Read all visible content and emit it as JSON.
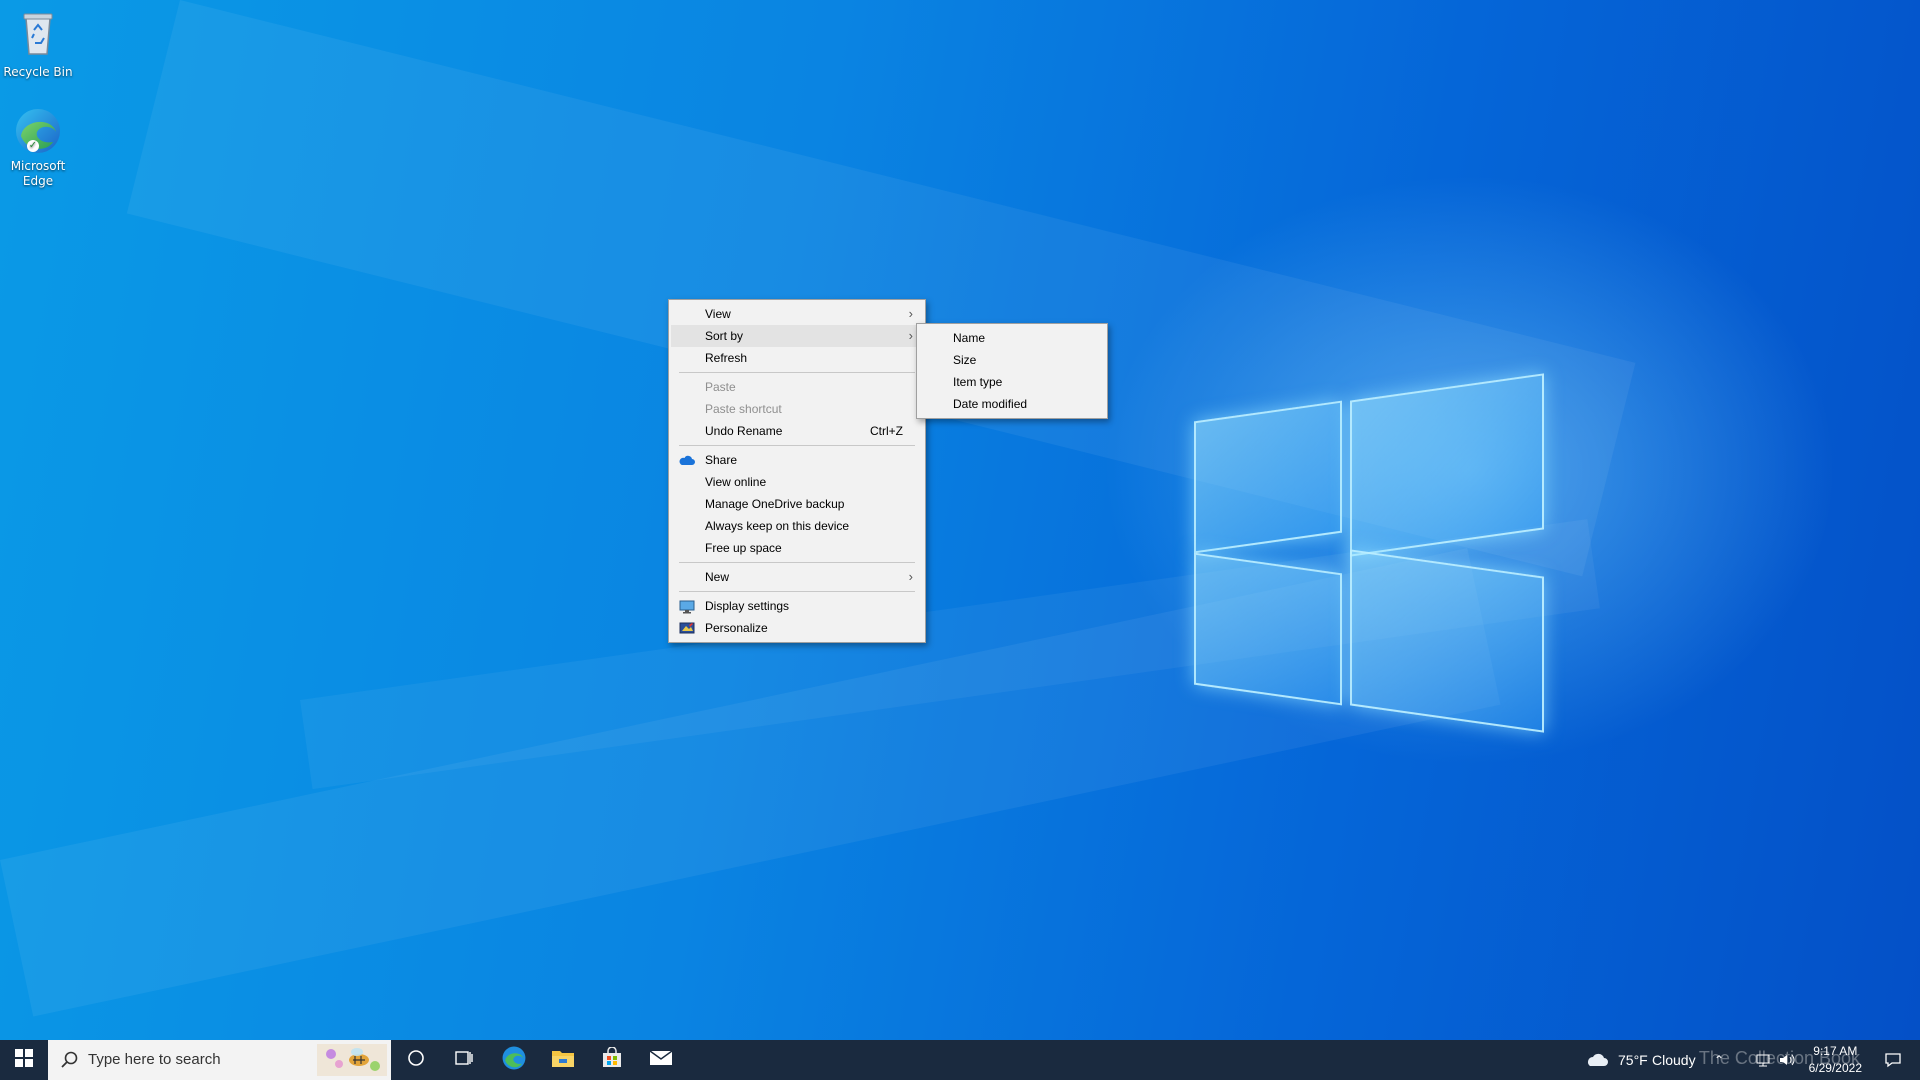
{
  "desktop": {
    "icons": [
      {
        "label": "Recycle Bin",
        "icon": "recycle-bin-icon"
      },
      {
        "label": "Microsoft Edge",
        "icon": "edge-icon"
      }
    ]
  },
  "context_menu": {
    "items": {
      "view": "View",
      "sort_by": "Sort by",
      "refresh": "Refresh",
      "paste": "Paste",
      "paste_shortcut": "Paste shortcut",
      "undo_rename": "Undo Rename",
      "undo_shortcut": "Ctrl+Z",
      "share": "Share",
      "view_online": "View online",
      "manage_onedrive": "Manage OneDrive backup",
      "always_keep": "Always keep on this device",
      "free_up": "Free up space",
      "new": "New",
      "display_settings": "Display settings",
      "personalize": "Personalize"
    },
    "highlighted": "Sort by"
  },
  "sort_submenu": {
    "items": [
      "Name",
      "Size",
      "Item type",
      "Date modified"
    ]
  },
  "taskbar": {
    "search_placeholder": "Type here to search",
    "pinned": [
      "cortana-icon",
      "task-view-icon",
      "edge-icon",
      "file-explorer-icon",
      "store-icon",
      "mail-icon"
    ],
    "weather_temp": "75°F",
    "weather_text": "Cloudy",
    "time": "9:17 AM",
    "date": "6/29/2022",
    "watermark": "The Collection Book"
  },
  "colors": {
    "taskbar_bg": "#1a2a3f",
    "menu_bg": "#f2f2f2",
    "menu_highlight": "#e3e3e3",
    "accent": "#0a84e2"
  }
}
